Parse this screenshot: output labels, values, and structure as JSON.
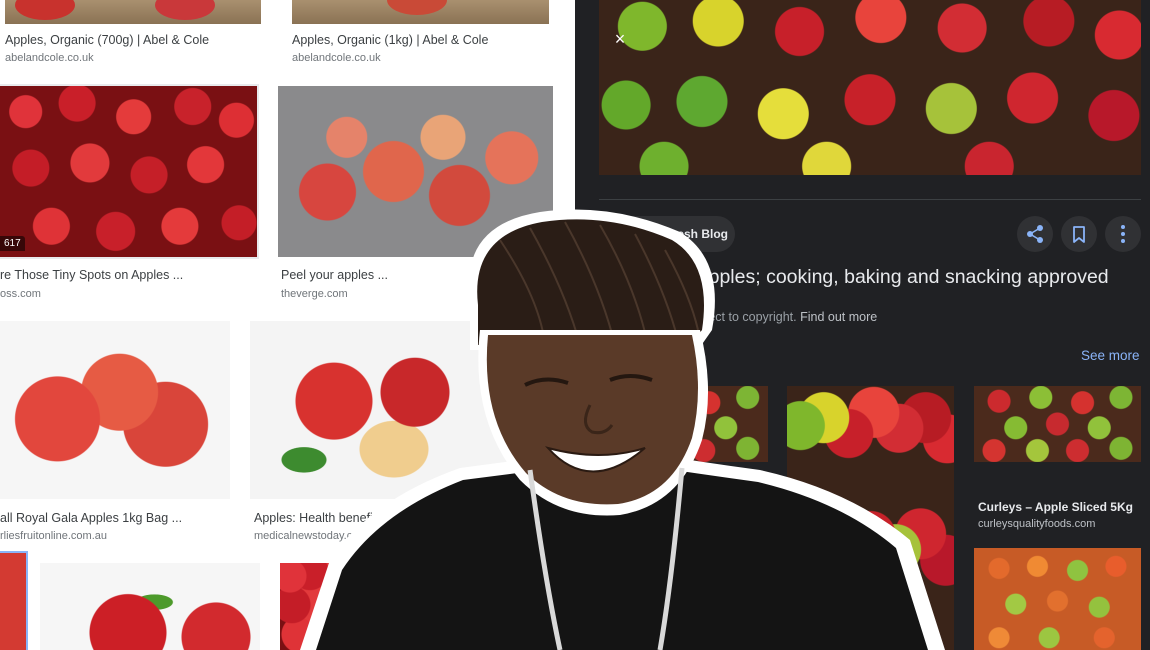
{
  "results": [
    {
      "caption": "Apples, Organic (700g) | Abel & Cole",
      "domain": "abelandcole.co.uk"
    },
    {
      "caption": "Apples, Organic (1kg) | Abel & Cole",
      "domain": "abelandcole.co.uk"
    },
    {
      "caption": "re Those Tiny Spots on Apples ...",
      "domain": "oss.com",
      "badge": "617"
    },
    {
      "caption": "Peel your apples ...",
      "domain": "theverge.com"
    },
    {
      "caption": "all Royal Gala Apples 1kg Bag ...",
      "domain": "rliesfruitonline.com.au"
    },
    {
      "caption": "Apples: Health benefits, facts, re",
      "domain": "medicalnewstoday.com"
    }
  ],
  "panel": {
    "close_glyph": "×",
    "source": "HelloFresh Blog",
    "title": "to Apples; cooking, baking and snacking approved",
    "copyright": "e subject to copyright.",
    "find_out_more": "Find out more",
    "related_label": "s",
    "see_more": "See more",
    "related": [
      {
        "caption": "Curleys – Apple Sliced 5Kg",
        "domain": "curleysqualityfoods.com"
      }
    ]
  },
  "colors": {
    "panel_bg": "#202124",
    "link_blue": "#8ab4f8",
    "chip_bg": "#303134"
  },
  "icons": [
    "close-icon",
    "globe-icon",
    "share-icon",
    "bookmark-icon",
    "more-vert-icon"
  ]
}
